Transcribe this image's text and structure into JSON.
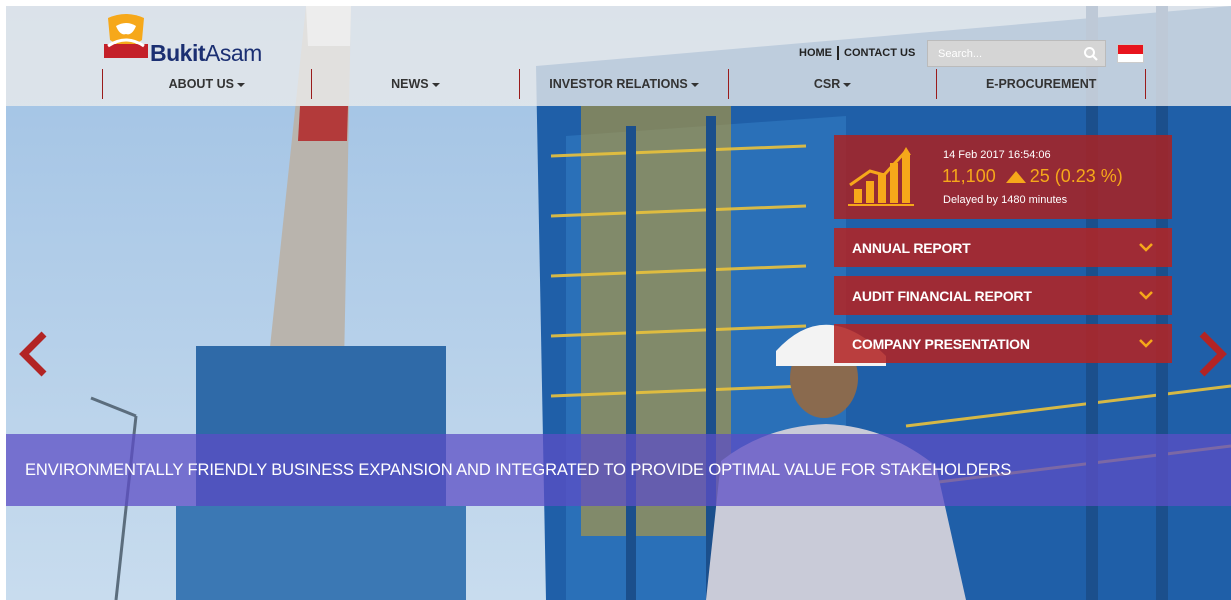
{
  "brand": {
    "name_bold": "Bukit",
    "name_light": "Asam"
  },
  "top_links": {
    "home": "HOME",
    "contact": "CONTACT US"
  },
  "search": {
    "placeholder": "Search..."
  },
  "nav": [
    {
      "label": "ABOUT US",
      "dropdown": true
    },
    {
      "label": "NEWS",
      "dropdown": true
    },
    {
      "label": "INVESTOR RELATIONS",
      "dropdown": true
    },
    {
      "label": "CSR",
      "dropdown": true
    },
    {
      "label": "E-PROCUREMENT",
      "dropdown": false
    }
  ],
  "stock": {
    "datetime": "14 Feb 2017 16:54:06",
    "price": "11,100",
    "change": "25 (0.23 %)",
    "delay": "Delayed by 1480 minutes"
  },
  "reports": [
    {
      "label": "ANNUAL REPORT"
    },
    {
      "label": "AUDIT FINANCIAL REPORT"
    },
    {
      "label": "COMPANY PRESENTATION"
    }
  ],
  "slider": {
    "caption": "ENVIRONMENTALLY FRIENDLY BUSINESS EXPANSION AND INTEGRATED TO PROVIDE OPTIMAL VALUE FOR STAKEHOLDERS"
  },
  "colors": {
    "brand_red": "#b22424",
    "brand_navy": "#1b2f72",
    "accent_orange": "#f6a81a",
    "caption_purple": "#5c4dc6"
  },
  "icons": {
    "search": "search-icon",
    "flag": "indonesia-flag-icon",
    "stock": "bar-chart-growth-icon",
    "chevron": "chevron-down-icon",
    "prev": "chevron-left-icon",
    "next": "chevron-right-icon"
  }
}
